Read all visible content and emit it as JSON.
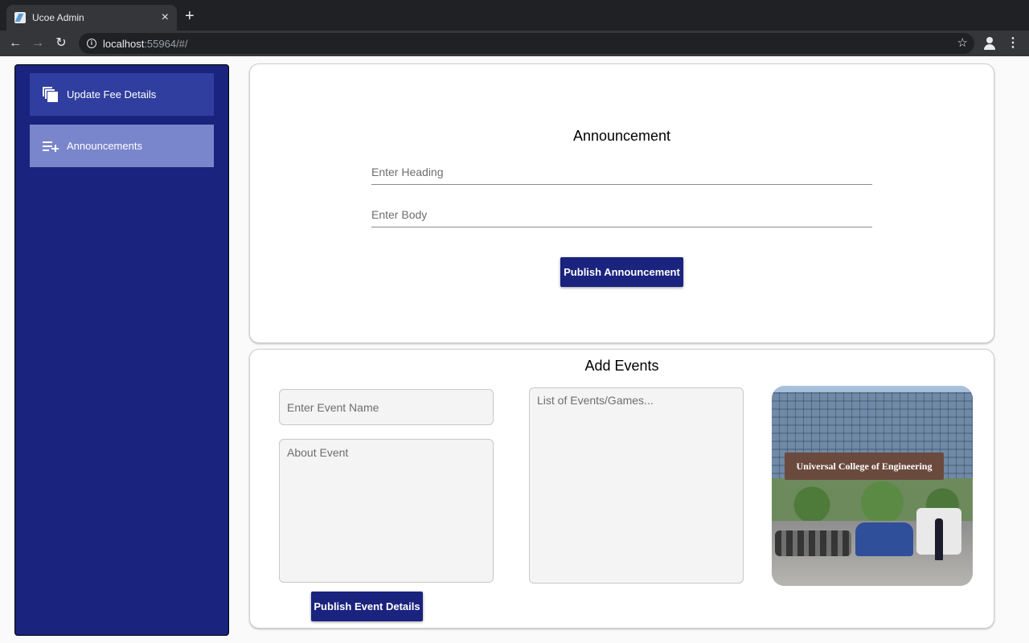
{
  "browser": {
    "tab_title": "Ucoe Admin",
    "tab_close": "×",
    "new_tab": "+",
    "url_host": "localhost",
    "url_rest": ":55964/#/",
    "icons": [
      "back-icon",
      "forward-icon",
      "reload-icon",
      "info-icon",
      "star-icon",
      "profile-icon",
      "menu-icon"
    ]
  },
  "sidebar": {
    "items": [
      {
        "label": "Update Fee Details",
        "icon": "copy-icon"
      },
      {
        "label": "Announcements",
        "icon": "playlist-add-icon",
        "selected": true
      }
    ]
  },
  "announcement": {
    "title": "Announcement",
    "heading_placeholder": "Enter Heading",
    "body_placeholder": "Enter Body",
    "publish_label": "Publish Announcement"
  },
  "events": {
    "title": "Add Events",
    "name_placeholder": "Enter Event Name",
    "about_placeholder": "About Event",
    "list_placeholder": "List of Events/Games...",
    "publish_label": "Publish Event Details",
    "photo_sign": "Universal College of Engineering"
  },
  "colors": {
    "sidebar_bg": "#1a237e",
    "sidebar_item_bg": "#303f9f",
    "sidebar_selected_bg": "#7986cb",
    "button_bg": "#1a237e"
  }
}
